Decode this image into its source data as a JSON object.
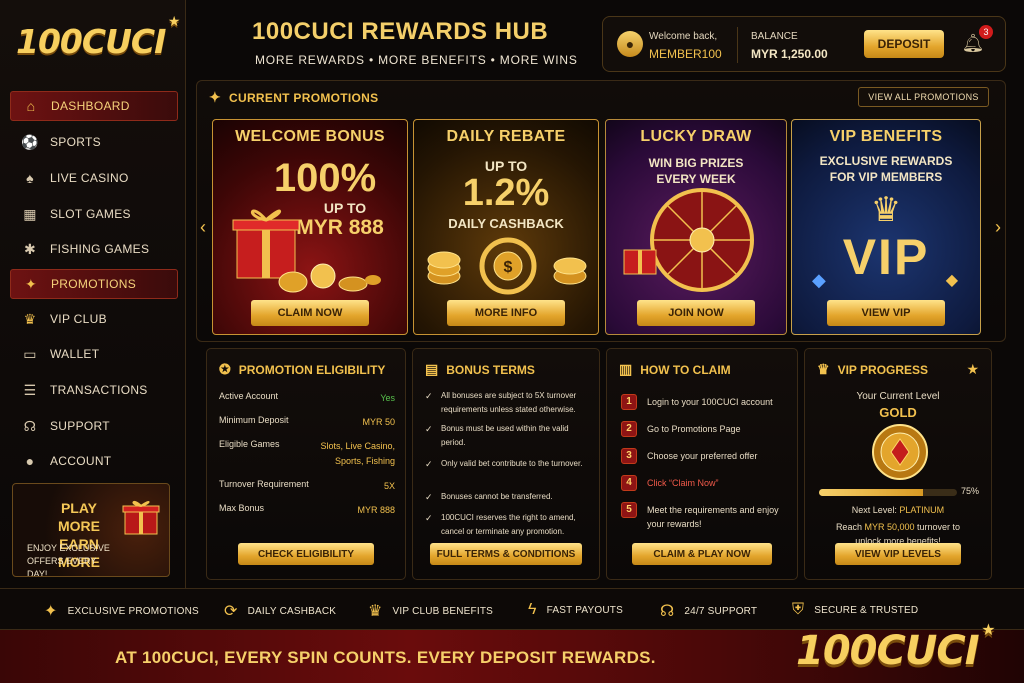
{
  "brand": {
    "logo": "100CUCI",
    "logo_star": "★"
  },
  "sidebar": {
    "items": [
      {
        "label": "DASHBOARD",
        "icon": "home-icon",
        "glyph": "⌂",
        "active": true
      },
      {
        "label": "SPORTS",
        "icon": "soccer-ball-icon",
        "glyph": "⚽"
      },
      {
        "label": "LIVE CASINO",
        "icon": "spade-icon",
        "glyph": "♠"
      },
      {
        "label": "SLOT GAMES",
        "icon": "slot-machine-icon",
        "glyph": "▦"
      },
      {
        "label": "FISHING GAMES",
        "icon": "fish-icon",
        "glyph": "✱"
      },
      {
        "label": "PROMOTIONS",
        "icon": "gift-icon",
        "glyph": "🎁",
        "active_sub": true
      },
      {
        "label": "VIP CLUB",
        "icon": "crown-icon",
        "glyph": "♛"
      },
      {
        "label": "WALLET",
        "icon": "wallet-icon",
        "glyph": "▭"
      },
      {
        "label": "TRANSACTIONS",
        "icon": "list-icon",
        "glyph": "☰"
      },
      {
        "label": "SUPPORT",
        "icon": "headset-icon",
        "glyph": "☊"
      },
      {
        "label": "ACCOUNT",
        "icon": "user-icon",
        "glyph": "👤"
      }
    ],
    "playmore": {
      "title": "PLAY MORE EARN MORE",
      "subtitle": "ENJOY EXCLUSIVE OFFERS EVERY DAY!"
    }
  },
  "header": {
    "title": "100CUCI REWARDS HUB",
    "subtitle": "MORE REWARDS • MORE BENEFITS • MORE WINS",
    "welcome": "Welcome back,",
    "username": "MEMBER100",
    "balance_label": "BALANCE",
    "balance_value": "MYR 1,250.00",
    "deposit_label": "DEPOSIT",
    "notifications": "3"
  },
  "promotions": {
    "heading": "CURRENT PROMOTIONS",
    "view_all": "VIEW ALL PROMOTIONS",
    "cards": [
      {
        "title": "WELCOME BONUS",
        "big": "100%",
        "line1": "UP TO",
        "line2": "MYR 888",
        "button": "CLAIM NOW"
      },
      {
        "title": "DAILY REBATE",
        "line0": "UP TO",
        "big": "1.2%",
        "line1": "DAILY CASHBACK",
        "button": "MORE INFO"
      },
      {
        "title": "LUCKY DRAW",
        "line1": "WIN BIG PRIZES",
        "line2": "EVERY WEEK",
        "button": "JOIN NOW"
      },
      {
        "title": "VIP BENEFITS",
        "line1": "EXCLUSIVE REWARDS",
        "line2": "FOR VIP MEMBERS",
        "big": "VIP",
        "button": "VIEW VIP"
      }
    ]
  },
  "eligibility": {
    "heading": "PROMOTION ELIGIBILITY",
    "rows": [
      {
        "label": "Active Account",
        "value": "Yes"
      },
      {
        "label": "Minimum Deposit",
        "value": "MYR 50"
      },
      {
        "label": "Eligible Games",
        "value": "Slots, Live Casino, Sports, Fishing"
      },
      {
        "label": "Turnover Requirement",
        "value": "5X"
      },
      {
        "label": "Max Bonus",
        "value": "MYR 888"
      }
    ],
    "button": "CHECK ELIGIBILITY"
  },
  "terms": {
    "heading": "BONUS TERMS",
    "items": [
      "All bonuses are subject to 5X turnover requirements unless stated otherwise.",
      "Bonus must be used within the valid period.",
      "Only valid bet contribute to the turnover.",
      "Bonuses cannot be transferred.",
      "100CUCI reserves the right to amend, cancel or terminate any promotion."
    ],
    "button": "FULL TERMS & CONDITIONS"
  },
  "claim": {
    "heading": "HOW TO CLAIM",
    "steps": [
      {
        "n": "1",
        "text": "Login to your 100CUCI account"
      },
      {
        "n": "2",
        "text": "Go to Promotions Page"
      },
      {
        "n": "3",
        "text": "Choose your preferred offer"
      },
      {
        "n": "4",
        "text": "Click “Claim Now”"
      },
      {
        "n": "5",
        "text": "Meet the requirements and enjoy your rewards!"
      }
    ],
    "button": "CLAIM & PLAY NOW"
  },
  "vip": {
    "heading": "VIP PROGRESS",
    "current_label": "Your Current Level",
    "current_level": "GOLD",
    "progress": 0.75,
    "progress_text": "75%",
    "next_label": "Next Level:",
    "next_level": "PLATINUM",
    "reach_prefix": "Reach",
    "reach_amount": "MYR 50,000",
    "reach_suffix": "turnover to unlock more benefits!",
    "button": "VIEW VIP LEVELS"
  },
  "features": [
    {
      "label": "EXCLUSIVE PROMOTIONS",
      "icon": "gift-icon",
      "glyph": "🎁"
    },
    {
      "label": "DAILY CASHBACK",
      "icon": "cashback-icon",
      "glyph": "⟳"
    },
    {
      "label": "VIP CLUB BENEFITS",
      "icon": "crown-icon",
      "glyph": "♛"
    },
    {
      "label": "FAST PAYOUTS",
      "icon": "lightning-icon",
      "glyph": "⚡"
    },
    {
      "label": "24/7 SUPPORT",
      "icon": "headset-icon",
      "glyph": "☊"
    },
    {
      "label": "SECURE & TRUSTED",
      "icon": "shield-icon",
      "glyph": "⛨"
    }
  ],
  "footer": {
    "tagline": "AT 100CUCI, EVERY SPIN COUNTS. EVERY DEPOSIT REWARDS.",
    "logo": "100CUCI"
  }
}
